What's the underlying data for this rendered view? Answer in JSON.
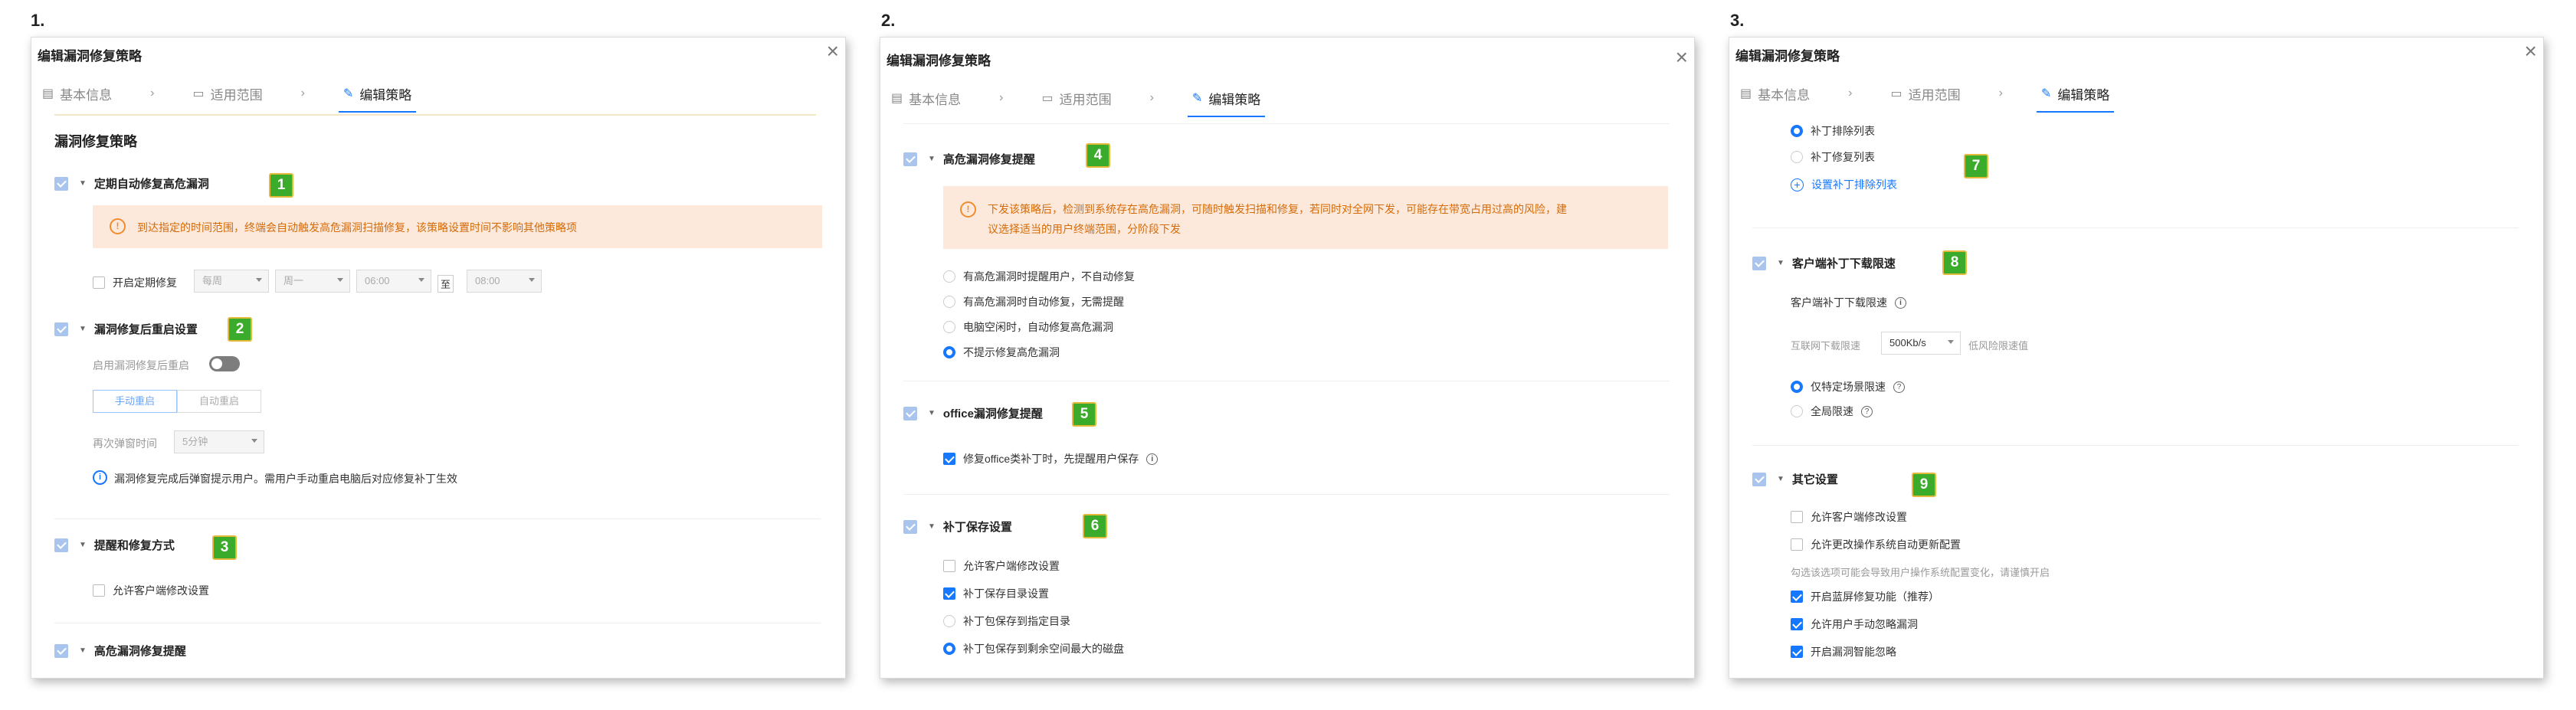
{
  "steps": [
    "1.",
    "2.",
    "3."
  ],
  "dialog": {
    "title": "编辑漏洞修复策略",
    "tabs": [
      "基本信息",
      "适用范围",
      "编辑策略"
    ],
    "close": "×"
  },
  "panel1": {
    "heading": "漏洞修复策略",
    "sec1": {
      "title": "定期自动修复高危漏洞",
      "badge": "1",
      "warning": "到达指定的时间范围，终端会自动触发高危漏洞扫描修复，该策略设置时间不影响其他策略项",
      "enable_label": "开启定期修复",
      "sel_freq": "每周",
      "sel_day": "周一",
      "sel_start": "06:00",
      "to": "至",
      "sel_end": "08:00"
    },
    "sec2": {
      "title": "漏洞修复后重启设置",
      "badge": "2",
      "reboot_label": "启用漏洞修复后重启",
      "btn_manual": "手动重启",
      "btn_auto": "自动重启",
      "popup_label": "再次弹窗时间",
      "popup_value": "5分钟",
      "info": "漏洞修复完成后弹窗提示用户。需用户手动重启电脑后对应修复补丁生效"
    },
    "sec3": {
      "title": "提醒和修复方式",
      "badge": "3",
      "allow_client": "允许客户端修改设置"
    },
    "sec4": {
      "title": "高危漏洞修复提醒"
    }
  },
  "panel2": {
    "sec4": {
      "title": "高危漏洞修复提醒",
      "badge": "4",
      "warning_line1": "下发该策略后，检测到系统存在高危漏洞，可随时触发扫描和修复，若同时对全网下发，可能存在带宽占用过高的风险，建",
      "warning_line2": "议选择适当的用户终端范围，分阶段下发",
      "options": [
        "有高危漏洞时提醒用户，不自动修复",
        "有高危漏洞时自动修复，无需提醒",
        "电脑空闲时，自动修复高危漏洞",
        "不提示修复高危漏洞"
      ]
    },
    "sec5": {
      "title": "office漏洞修复提醒",
      "badge": "5",
      "option": "修复office类补丁时，先提醒用户保存"
    },
    "sec6": {
      "title": "补丁保存设置",
      "badge": "6",
      "allow_client": "允许客户端修改设置",
      "save_dir": "补丁保存目录设置",
      "opt_specified": "补丁包保存到指定目录",
      "opt_largest": "补丁包保存到剩余空间最大的磁盘"
    }
  },
  "panel3": {
    "sec7": {
      "badge": "7",
      "opt_exclude": "补丁排除列表",
      "opt_fix": "补丁修复列表",
      "link": "设置补丁排除列表"
    },
    "sec8": {
      "title": "客户端补丁下载限速",
      "badge": "8",
      "label": "客户端补丁下载限速",
      "net_label": "互联网下载限速",
      "speed": "500Kb/s",
      "low_risk": "低风险限速值",
      "opt_scene": "仅特定场景限速",
      "opt_all": "全局限速"
    },
    "sec9": {
      "title": "其它设置",
      "badge": "9",
      "items": [
        "允许客户端修改设置",
        "允许更改操作系统自动更新配置"
      ],
      "hint": "勾选该选项可能会导致用户操作系统配置变化，请谨慎开启",
      "checked_items": [
        "开启蓝屏修复功能（推荐）",
        "允许用户手动忽略漏洞",
        "开启漏洞智能忽略"
      ]
    }
  }
}
